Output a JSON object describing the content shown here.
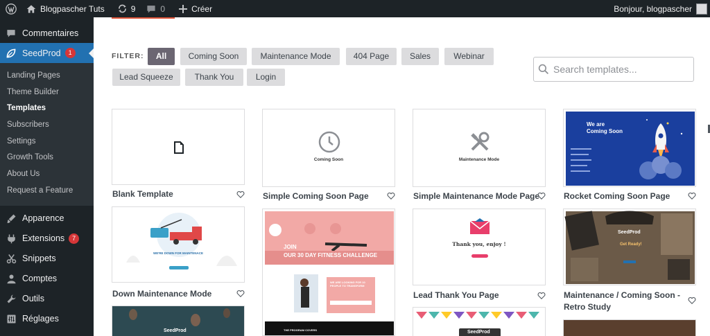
{
  "adminbar": {
    "site_name": "Blogpascher Tuts",
    "updates_count": "9",
    "comments_count": "0",
    "new_label": "Créer",
    "greeting": "Bonjour, blogpascher"
  },
  "sidebar": {
    "comments": "Commentaires",
    "seedprod": "SeedProd",
    "seedprod_badge": "1",
    "submenu": [
      "Landing Pages",
      "Theme Builder",
      "Templates",
      "Subscribers",
      "Settings",
      "Growth Tools",
      "About Us",
      "Request a Feature"
    ],
    "appearance": "Apparence",
    "extensions": "Extensions",
    "extensions_badge": "7",
    "snippets": "Snippets",
    "accounts": "Comptes",
    "tools": "Outils",
    "settings": "Réglages"
  },
  "filter": {
    "label": "FILTER:",
    "chips": [
      "All",
      "Coming Soon",
      "Maintenance Mode",
      "404 Page",
      "Sales",
      "Webinar",
      "Lead Squeeze",
      "Thank You",
      "Login"
    ],
    "active": "All"
  },
  "search": {
    "placeholder": "Search templates..."
  },
  "templates": {
    "blank": "Blank Template",
    "simple_coming_soon": "Simple Coming Soon Page",
    "simple_maintenance": "Simple Maintenance Mode Page",
    "rocket_coming_soon": "Rocket Coming Soon Page",
    "down_maintenance": "Down Maintenance Mode",
    "lead_thank_you": "Lead Thank You Page",
    "retro_study_line1": "Maintenance / Coming Soon -",
    "retro_study_line2": "Retro Study"
  },
  "previews": {
    "coming_soon_text": "Coming Soon",
    "maintenance_text": "Maintenance Mode",
    "rocket_line1": "We are",
    "rocket_line2": "Coming Soon",
    "down_text": "WE'RE DOWN FOR MAINTENACE",
    "fitness_line1": "JOIN",
    "fitness_line2": "OUR 30 DAY FITNESS CHALLENGE",
    "fitness_box": "WE ARE LOOKING FOR 10 PEOPLE TO TRANSFORM",
    "fitness_footer": "THE PROGRAM COVERS",
    "thankyou_text": "Thank you, enjoy !",
    "seedprod_logo": "SeedProd",
    "get_ready": "Get Ready!"
  },
  "colors": {
    "admin_dark": "#1d2327",
    "active_blue": "#2271b1",
    "chip_active": "#6b6672",
    "chip": "#dcdcde",
    "rocket_bg": "#1a3f9e",
    "fitness_pink": "#f0a0a0"
  }
}
